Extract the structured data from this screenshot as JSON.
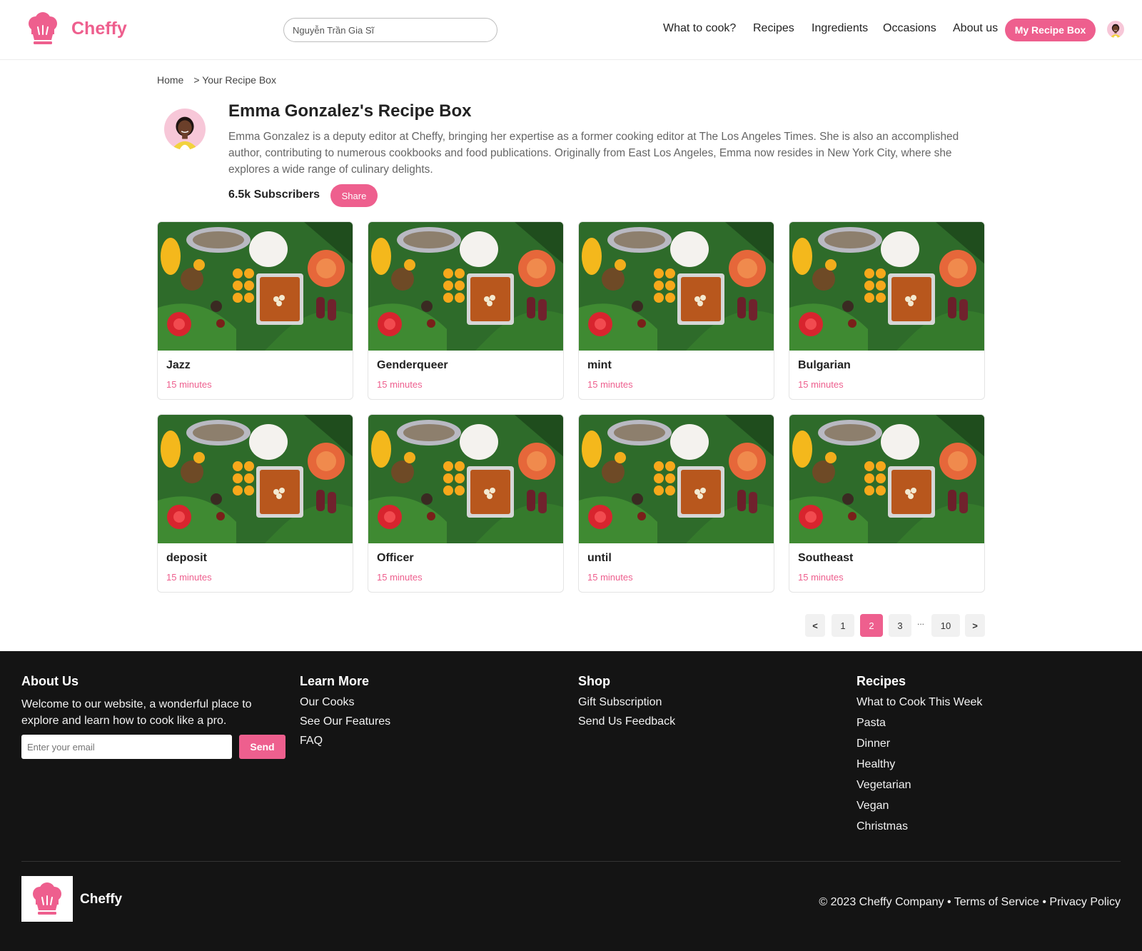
{
  "brand": {
    "name": "Cheffy",
    "accent": "#ee5f8e"
  },
  "header": {
    "search_value": "Nguyễn Trần Gia Sĩ",
    "nav": [
      "What to cook?",
      "Recipes",
      "Ingredients",
      "Occasions",
      "About us"
    ],
    "cta": "My Recipe Box",
    "avatar_icon": "user-avatar-icon"
  },
  "breadcrumb": {
    "home": "Home",
    "separator": ">",
    "current": "Your Recipe Box"
  },
  "profile": {
    "title": "Emma Gonzalez's Recipe Box",
    "bio": "Emma Gonzalez is a deputy editor at Cheffy, bringing her expertise as a former cooking editor at The Los Angeles Times. She is also an accomplished author, contributing to numerous cookbooks and food publications. Originally from East Los Angeles, Emma now resides in New York City, where she explores a wide range of culinary delights.",
    "subscribers": "6.5k Subscribers",
    "share_label": "Share"
  },
  "recipes": [
    {
      "title": "Jazz",
      "time": "15 minutes"
    },
    {
      "title": "Genderqueer",
      "time": "15 minutes"
    },
    {
      "title": "mint",
      "time": "15 minutes"
    },
    {
      "title": "Bulgarian",
      "time": "15 minutes"
    },
    {
      "title": "deposit",
      "time": "15 minutes"
    },
    {
      "title": "Officer",
      "time": "15 minutes"
    },
    {
      "title": "until",
      "time": "15 minutes"
    },
    {
      "title": "Southeast",
      "time": "15 minutes"
    }
  ],
  "pagination": {
    "prev": "<",
    "pages": [
      "1",
      "2",
      "3"
    ],
    "current": "2",
    "ellipsis": "...",
    "last": "10",
    "next": ">"
  },
  "footer": {
    "about": {
      "heading": "About Us",
      "text": "Welcome to our website, a wonderful place to explore and learn how to cook like a pro.",
      "email_placeholder": "Enter your email",
      "send_label": "Send"
    },
    "learn_more": {
      "heading": "Learn More",
      "links": [
        "Our Cooks",
        "See Our Features",
        "FAQ"
      ]
    },
    "shop": {
      "heading": "Shop",
      "links": [
        "Gift Subscription",
        "Send Us Feedback"
      ]
    },
    "recipes": {
      "heading": "Recipes",
      "links": [
        "What to Cook This Week",
        "Pasta",
        "Dinner",
        "Healthy",
        "Vegetarian",
        "Vegan",
        "Christmas"
      ]
    },
    "brand": "Cheffy",
    "copyright": "© 2023 Cheffy Company",
    "bullet": "•",
    "terms": "Terms of Service",
    "privacy": "Privacy Policy"
  }
}
